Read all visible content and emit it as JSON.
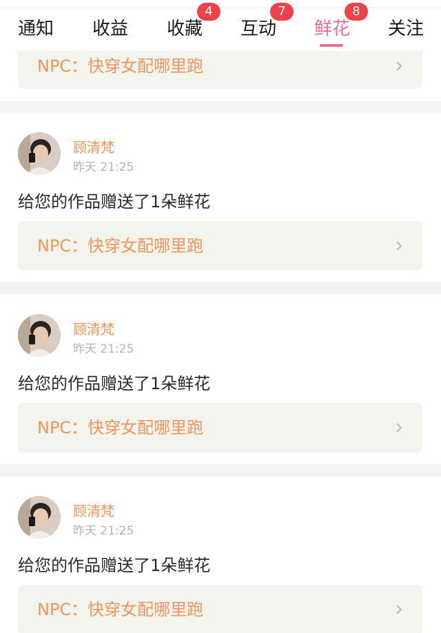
{
  "tabs": [
    {
      "label": "通知",
      "badge": ""
    },
    {
      "label": "收益",
      "badge": ""
    },
    {
      "label": "收藏",
      "badge": "4"
    },
    {
      "label": "互动",
      "badge": "7"
    },
    {
      "label": "鲜花",
      "badge": "8",
      "active": true
    },
    {
      "label": "关注",
      "badge": ""
    }
  ],
  "colors": {
    "accent": "#e86b9a",
    "badge": "#f0404a",
    "name": "#f0955a"
  },
  "top_card": {
    "book_title": "NPC：快穿女配哪里跑"
  },
  "gifts": [
    {
      "username": "顾清梵",
      "time": "昨天 21:25",
      "message": "给您的作品赠送了1朵鲜花",
      "book_title": "NPC：快穿女配哪里跑"
    },
    {
      "username": "顾清梵",
      "time": "昨天 21:25",
      "message": "给您的作品赠送了1朵鲜花",
      "book_title": "NPC：快穿女配哪里跑"
    },
    {
      "username": "顾清梵",
      "time": "昨天 21:25",
      "message": "给您的作品赠送了1朵鲜花",
      "book_title": "NPC：快穿女配哪里跑"
    }
  ],
  "icons": {
    "chevron": "chevron-right-icon",
    "avatar": "avatar"
  }
}
